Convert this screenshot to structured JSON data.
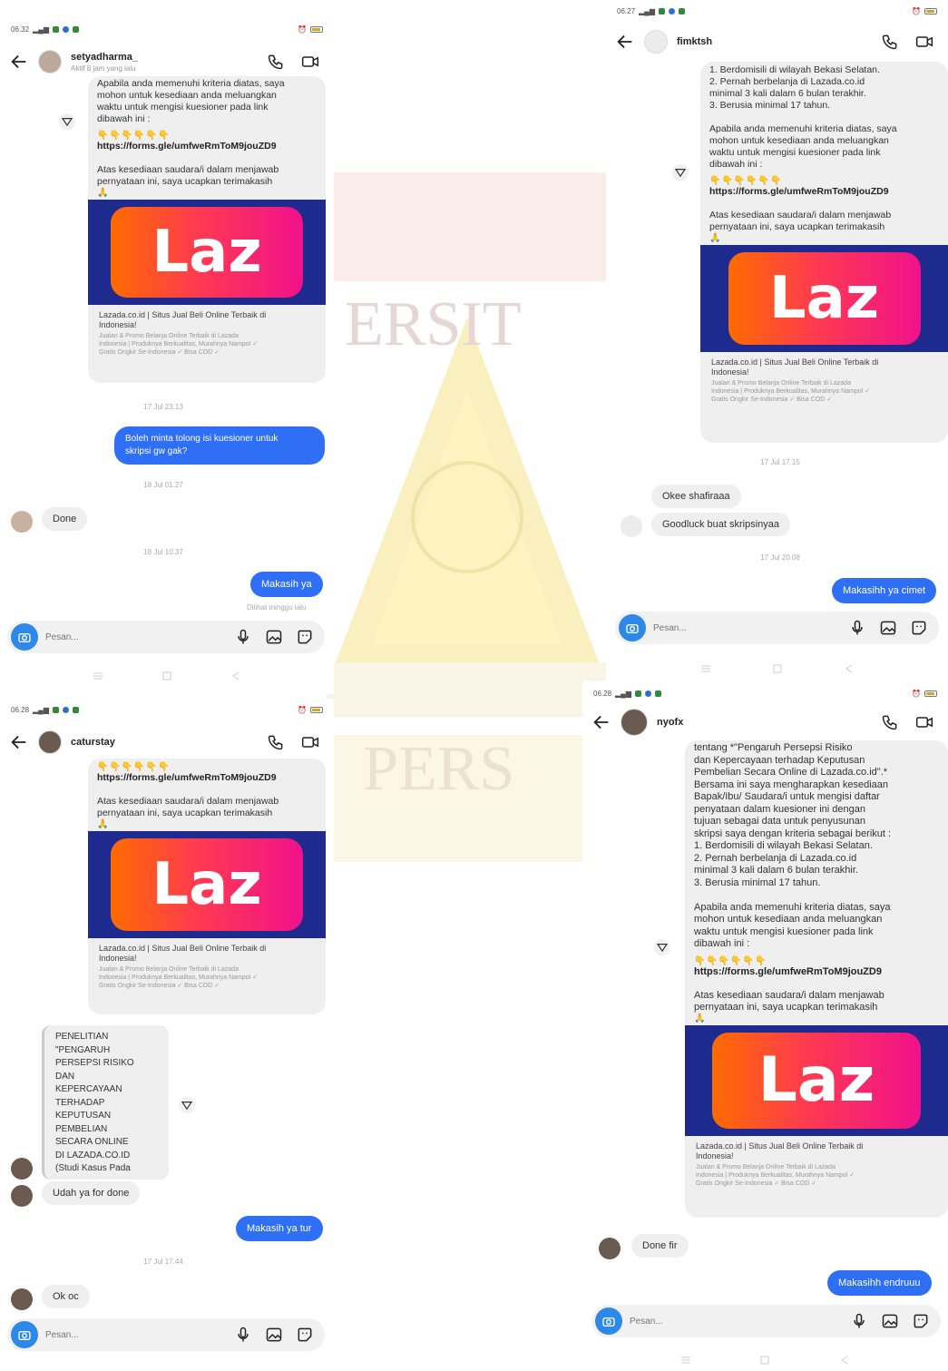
{
  "watermark": {
    "top_text": "ERSIT",
    "bottom_text": "PERS"
  },
  "panel1": {
    "status_time": "06.32",
    "username": "setyadharma_",
    "subtitle": "Aktif 8 jam yang lalu",
    "message_text": "Apabila anda memenuhi kriteria diatas, saya\nmohon untuk kesediaan anda  meluangkan\nwaktu untuk mengisi kuesioner pada link\ndibawah ini :",
    "emojis": "👇👇👇👇👇👇",
    "link": "https://forms.gle/umfweRmToM9jouZD9",
    "thanks_text": "Atas kesediaan saudara/i dalam menjawab\npernyataan ini, saya ucapkan terimakasih",
    "pray": "🙏",
    "laz_word": "Laz",
    "laz_caption": "Lazada.co.id | Situs Jual Beli Online Terbaik di\nIndonesia!",
    "laz_desc": "Jualan & Promo Belanja Online Terbaik di Lazada\nIndonesia | Produknya Berkualitas, Murahnya Nampol ✓\nGratis Ongkir Se-Indonesia ✓ Bisa COD ✓",
    "ts1": "17 Jul 23.13",
    "out1": "Boleh minta tolong isi kuesioner untuk\nskripsi gw gak?",
    "ts2": "18 Jul 01.27",
    "in1": "Done",
    "ts3": "18 Jul 10.37",
    "out2": "Makasih ya",
    "seen": "Dilihat minggu lalu",
    "composer_placeholder": "Pesan..."
  },
  "panel2": {
    "status_time": "06.27",
    "username": "fimktsh",
    "message_text": "1. Berdomisili di wilayah Bekasi Selatan.\n2. Pernah berbelanja di Lazada.co.id\nminimal 3 kali dalam 6 bulan terakhir.\n3. Berusia minimal 17 tahun.\n\nApabila anda memenuhi kriteria diatas, saya\nmohon untuk kesediaan anda  meluangkan\nwaktu untuk mengisi kuesioner pada link\ndibawah ini :",
    "emojis": "👇👇👇👇👇👇",
    "link": "https://forms.gle/umfweRmToM9jouZD9",
    "thanks_text": "Atas kesediaan saudara/i dalam menjawab\npernyataan ini, saya ucapkan terimakasih",
    "pray": "🙏",
    "laz_word": "Laz",
    "laz_caption": "Lazada.co.id | Situs Jual Beli Online Terbaik di\nIndonesia!",
    "laz_desc": "Jualan & Promo Belanja Online Terbaik di Lazada\nIndonesia | Produknya Berkualitas, Murahnya Nampol ✓\nGratis Ongkir Se-Indonesia ✓ Bisa COD ✓",
    "ts1": "17 Jul 17.15",
    "in1": "Okee shafiraaa",
    "in2": "Goodluck buat skripsinyaa",
    "ts2": "17 Jul 20.08",
    "out1": "Makasihh ya cimet",
    "composer_placeholder": "Pesan..."
  },
  "panel3": {
    "status_time": "06.28",
    "username": "caturstay",
    "emojis": "👇👇👇👇👇👇",
    "link": "https://forms.gle/umfweRmToM9jouZD9",
    "thanks_text": "Atas kesediaan saudara/i dalam menjawab\npernyataan ini, saya ucapkan terimakasih",
    "pray": "🙏",
    "laz_word": "Laz",
    "laz_caption": "Lazada.co.id | Situs Jual Beli Online Terbaik di\nIndonesia!",
    "laz_desc": "Jualan & Promo Belanja Online Terbaik di Lazada\nIndonesia | Produknya Berkualitas, Murahnya Nampol ✓\nGratis Ongkir Se-Indonesia ✓ Bisa COD ✓",
    "quote_text": "PENELITIAN\n\"PENGARUH\nPERSEPSI RISIKO\nDAN\nKEPERCAYAAN\nTERHADAP\nKEPUTUSAN\nPEMBELIAN\nSECARA ONLINE\nDI LAZADA.CO.ID\n(Studi Kasus Pada",
    "in1": "Udah ya for done",
    "out1": "Makasih ya tur",
    "ts1": "17 Jul 17.44",
    "in2": "Ok oc",
    "composer_placeholder": "Pesan..."
  },
  "panel4": {
    "status_time": "06.28",
    "username": "nyofx",
    "message_text": "tentang *\"Pengaruh Persepsi Risiko\ndan Kepercayaan terhadap Keputusan\nPembelian Secara Online di Lazada.co.id\".*\nBersama ini saya mengharapkan kesediaan\nBapak/Ibu/ Saudara/i untuk mengisi daftar\npenyataan dalam kuesioner ini dengan\ntujuan sebagai data untuk penyusunan\nskripsi saya dengan kriteria sebagai berikut :\n1. Berdomisili di wilayah Bekasi Selatan.\n2. Pernah berbelanja di Lazada.co.id\nminimal 3 kali dalam 6 bulan terakhir.\n3. Berusia minimal 17 tahun.\n\nApabila anda memenuhi kriteria diatas, saya\nmohon untuk kesediaan anda  meluangkan\nwaktu untuk mengisi kuesioner pada link\ndibawah ini :",
    "emojis": "👇👇👇👇👇👇",
    "link": "https://forms.gle/umfweRmToM9jouZD9",
    "thanks_text": "Atas kesediaan saudara/i dalam menjawab\npernyataan ini, saya ucapkan terimakasih",
    "pray": "🙏",
    "laz_word": "Laz",
    "laz_caption": "Lazada.co.id | Situs Jual Beli Online Terbaik di\nIndonesia!",
    "laz_desc": "Jualan & Promo Belanja Online Terbaik di Lazada\nIndonesia | Produknya Berkualitas, Murahnya Nampol ✓\nGratis Ongkir Se-Indonesia ✓ Bisa COD ✓",
    "in1": "Done fir",
    "out1": "Makasihh endruuu",
    "composer_placeholder": "Pesan..."
  },
  "colors": {
    "outgoing_bubble": "#2f6ff5",
    "incoming_bubble": "#efefef",
    "laz_banner_bg": "#1f2a8f",
    "camera_button": "#2e88e8"
  },
  "icons": [
    "back-arrow-icon",
    "phone-icon",
    "video-camera-icon",
    "share-icon",
    "camera-icon",
    "microphone-icon",
    "gallery-icon",
    "sticker-icon"
  ]
}
